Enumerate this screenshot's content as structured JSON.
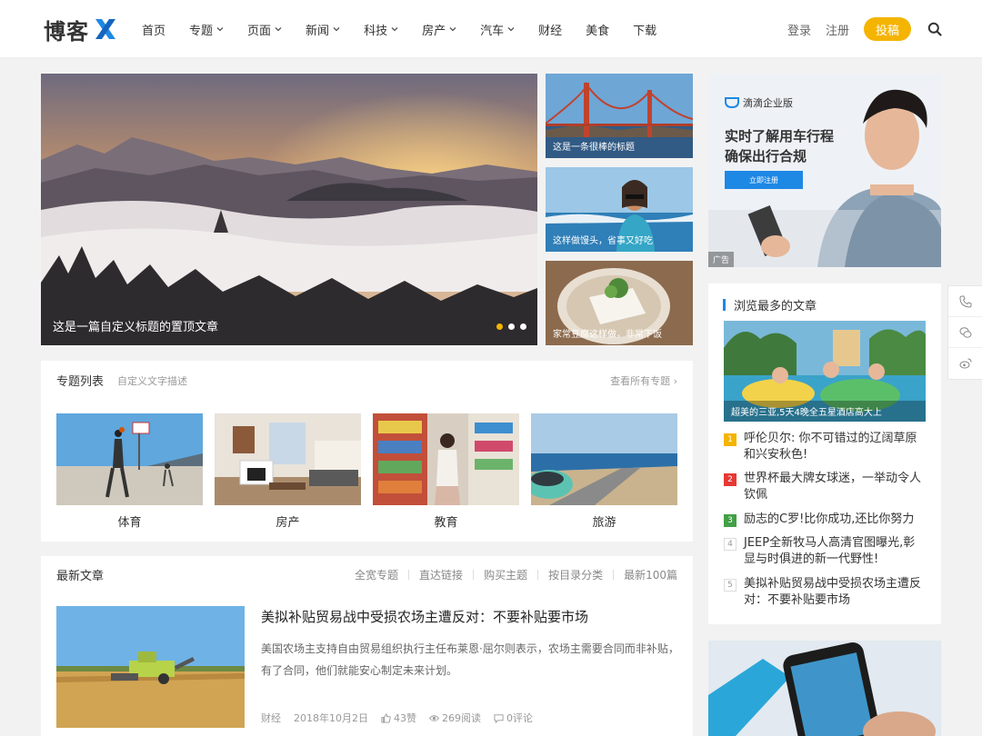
{
  "header": {
    "logo_text": "博客",
    "nav": [
      {
        "label": "首页",
        "dropdown": false
      },
      {
        "label": "专题",
        "dropdown": true
      },
      {
        "label": "页面",
        "dropdown": true
      },
      {
        "label": "新闻",
        "dropdown": true
      },
      {
        "label": "科技",
        "dropdown": true
      },
      {
        "label": "房产",
        "dropdown": true
      },
      {
        "label": "汽车",
        "dropdown": true
      },
      {
        "label": "财经",
        "dropdown": false
      },
      {
        "label": "美食",
        "dropdown": false
      },
      {
        "label": "下载",
        "dropdown": false
      }
    ],
    "login": "登录",
    "register": "注册",
    "post_button": "投稿",
    "search_icon": "search-icon"
  },
  "hero": {
    "main_caption": "这是一篇自定义标题的置顶文章",
    "slides_count": 3,
    "active_slide": 1,
    "side": [
      {
        "caption": "这是一条很棒的标题"
      },
      {
        "caption": "这样做馒头，省事又好吃"
      },
      {
        "caption": "家常豆腐这样做，非常下饭"
      }
    ]
  },
  "ad": {
    "brand": "滴滴企业版",
    "line1": "实时了解用车行程",
    "line2": "确保出行合规",
    "button": "立即注册",
    "tag": "广告"
  },
  "topics": {
    "title": "专题列表",
    "desc": "自定义文字描述",
    "more": "查看所有专题 ›",
    "items": [
      {
        "label": "体育"
      },
      {
        "label": "房产"
      },
      {
        "label": "教育"
      },
      {
        "label": "旅游"
      }
    ]
  },
  "latest": {
    "title": "最新文章",
    "links": [
      "全宽专题",
      "直达链接",
      "购买主题",
      "按目录分类",
      "最新100篇"
    ],
    "article": {
      "title": "美拟补贴贸易战中受损农场主遭反对：不要补贴要市场",
      "excerpt": "美国农场主支持自由贸易组织执行主任布莱恩·屈尔则表示，农场主需要合同而非补贴，有了合同，他们就能安心制定未来计划。",
      "category": "财经",
      "date": "2018年10月2日",
      "likes": "43赞",
      "views": "269阅读",
      "comments": "0评论"
    }
  },
  "popular": {
    "title": "浏览最多的文章",
    "image_caption": "超美的三亚,5天4晚全五星酒店高大上",
    "items": [
      {
        "rank": "1",
        "text": "呼伦贝尔: 你不可错过的辽阔草原和兴安秋色!"
      },
      {
        "rank": "2",
        "text": "世界杯最大牌女球迷，一举动令人钦佩"
      },
      {
        "rank": "3",
        "text": "励志的C罗!比你成功,还比你努力"
      },
      {
        "rank": "4",
        "text": "JEEP全新牧马人高清官图曝光,彰显与时俱进的新一代野性!"
      },
      {
        "rank": "5",
        "text": "美拟补贴贸易战中受损农场主遭反对：不要补贴要市场"
      }
    ]
  },
  "float_toolbar": [
    "phone-icon",
    "wechat-icon",
    "weibo-icon"
  ],
  "colors": {
    "accent": "#1e88e5",
    "post_button": "#f4b400",
    "rank1": "#f4b400",
    "rank2": "#e53935",
    "rank3": "#43a047"
  }
}
